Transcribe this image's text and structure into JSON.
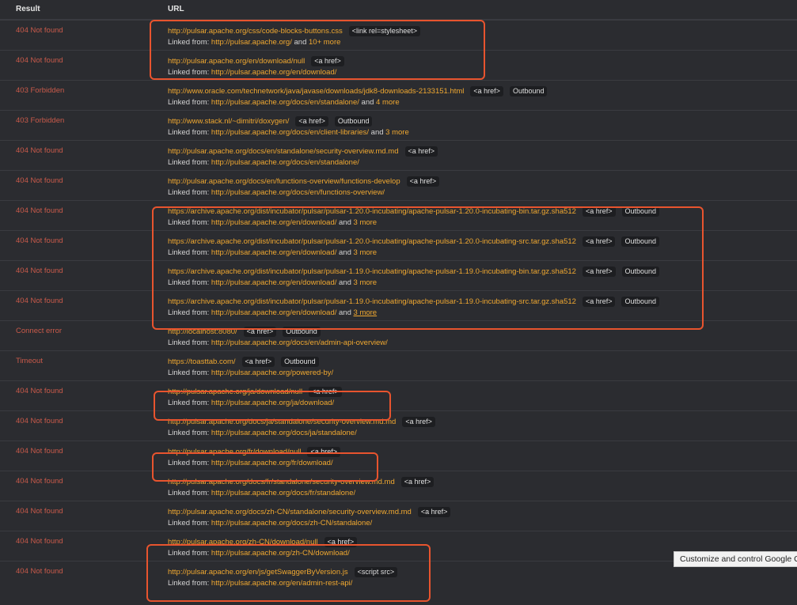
{
  "header": {
    "result": "Result",
    "url": "URL"
  },
  "linked_prefix": "Linked from: ",
  "rows": [
    {
      "result": "404 Not found",
      "url": "http://pulsar.apache.org/css/code-blocks-buttons.css",
      "tags": [
        "<link rel=stylesheet>"
      ],
      "from": "http://pulsar.apache.org/",
      "more": "and 10+ more"
    },
    {
      "result": "404 Not found",
      "url": "http://pulsar.apache.org/en/download/null",
      "tags": [
        "<a href>"
      ],
      "from": "http://pulsar.apache.org/en/download/",
      "more": ""
    },
    {
      "result": "403 Forbidden",
      "url": "http://www.oracle.com/technetwork/java/javase/downloads/jdk8-downloads-2133151.html",
      "tags": [
        "<a href>",
        "Outbound"
      ],
      "from": "http://pulsar.apache.org/docs/en/standalone/",
      "more": "and 4 more"
    },
    {
      "result": "403 Forbidden",
      "url": "http://www.stack.nl/~dimitri/doxygen/",
      "tags": [
        "<a href>",
        "Outbound"
      ],
      "from": "http://pulsar.apache.org/docs/en/client-libraries/",
      "more": "and 3 more"
    },
    {
      "result": "404 Not found",
      "url": "http://pulsar.apache.org/docs/en/standalone/security-overview.md.md",
      "tags": [
        "<a href>"
      ],
      "from": "http://pulsar.apache.org/docs/en/standalone/",
      "more": ""
    },
    {
      "result": "404 Not found",
      "url": "http://pulsar.apache.org/docs/en/functions-overview/functions-develop",
      "tags": [
        "<a href>"
      ],
      "from": "http://pulsar.apache.org/docs/en/functions-overview/",
      "more": ""
    },
    {
      "result": "404 Not found",
      "url": "https://archive.apache.org/dist/incubator/pulsar/pulsar-1.20.0-incubating/apache-pulsar-1.20.0-incubating-bin.tar.gz.sha512",
      "tags": [
        "<a href>",
        "Outbound"
      ],
      "from": "http://pulsar.apache.org/en/download/",
      "more": "and 3 more"
    },
    {
      "result": "404 Not found",
      "url": "https://archive.apache.org/dist/incubator/pulsar/pulsar-1.20.0-incubating/apache-pulsar-1.20.0-incubating-src.tar.gz.sha512",
      "tags": [
        "<a href>",
        "Outbound"
      ],
      "from": "http://pulsar.apache.org/en/download/",
      "more": "and 3 more"
    },
    {
      "result": "404 Not found",
      "url": "https://archive.apache.org/dist/incubator/pulsar/pulsar-1.19.0-incubating/apache-pulsar-1.19.0-incubating-bin.tar.gz.sha512",
      "tags": [
        "<a href>",
        "Outbound"
      ],
      "from": "http://pulsar.apache.org/en/download/",
      "more": "and 3 more"
    },
    {
      "result": "404 Not found",
      "url": "https://archive.apache.org/dist/incubator/pulsar/pulsar-1.19.0-incubating/apache-pulsar-1.19.0-incubating-src.tar.gz.sha512",
      "tags": [
        "<a href>",
        "Outbound"
      ],
      "from": "http://pulsar.apache.org/en/download/",
      "more": "and 3 more",
      "more_underlined": true
    },
    {
      "result": "Connect error",
      "url": "http://localhost:8080/",
      "tags": [
        "<a href>",
        "Outbound"
      ],
      "from": "http://pulsar.apache.org/docs/en/admin-api-overview/",
      "more": ""
    },
    {
      "result": "Timeout",
      "url": "https://toasttab.com/",
      "tags": [
        "<a href>",
        "Outbound"
      ],
      "from": "http://pulsar.apache.org/powered-by/",
      "more": ""
    },
    {
      "result": "404 Not found",
      "url": "http://pulsar.apache.org/ja/download/null",
      "tags": [
        "<a href>"
      ],
      "from": "http://pulsar.apache.org/ja/download/",
      "more": ""
    },
    {
      "result": "404 Not found",
      "url": "http://pulsar.apache.org/docs/ja/standalone/security-overview.md.md",
      "tags": [
        "<a href>"
      ],
      "from": "http://pulsar.apache.org/docs/ja/standalone/",
      "more": ""
    },
    {
      "result": "404 Not found",
      "url": "http://pulsar.apache.org/fr/download/null",
      "tags": [
        "<a href>"
      ],
      "from": "http://pulsar.apache.org/fr/download/",
      "more": ""
    },
    {
      "result": "404 Not found",
      "url": "http://pulsar.apache.org/docs/fr/standalone/security-overview.md.md",
      "tags": [
        "<a href>"
      ],
      "from": "http://pulsar.apache.org/docs/fr/standalone/",
      "more": ""
    },
    {
      "result": "404 Not found",
      "url": "http://pulsar.apache.org/docs/zh-CN/standalone/security-overview.md.md",
      "tags": [
        "<a href>"
      ],
      "from": "http://pulsar.apache.org/docs/zh-CN/standalone/",
      "more": ""
    },
    {
      "result": "404 Not found",
      "url": "http://pulsar.apache.org/zh-CN/download/null",
      "tags": [
        "<a href>"
      ],
      "from": "http://pulsar.apache.org/zh-CN/download/",
      "more": ""
    },
    {
      "result": "404 Not found",
      "url": "http://pulsar.apache.org/en/js/getSwaggerByVersion.js",
      "tags": [
        "<script src>"
      ],
      "from": "http://pulsar.apache.org/en/admin-rest-api/",
      "more": ""
    }
  ],
  "tooltip": "Customize and control Google Chrome",
  "colors": {
    "background": "#2b2c30",
    "result_error": "#c95a4a",
    "link": "#f0a830",
    "highlight": "#e8542e"
  }
}
